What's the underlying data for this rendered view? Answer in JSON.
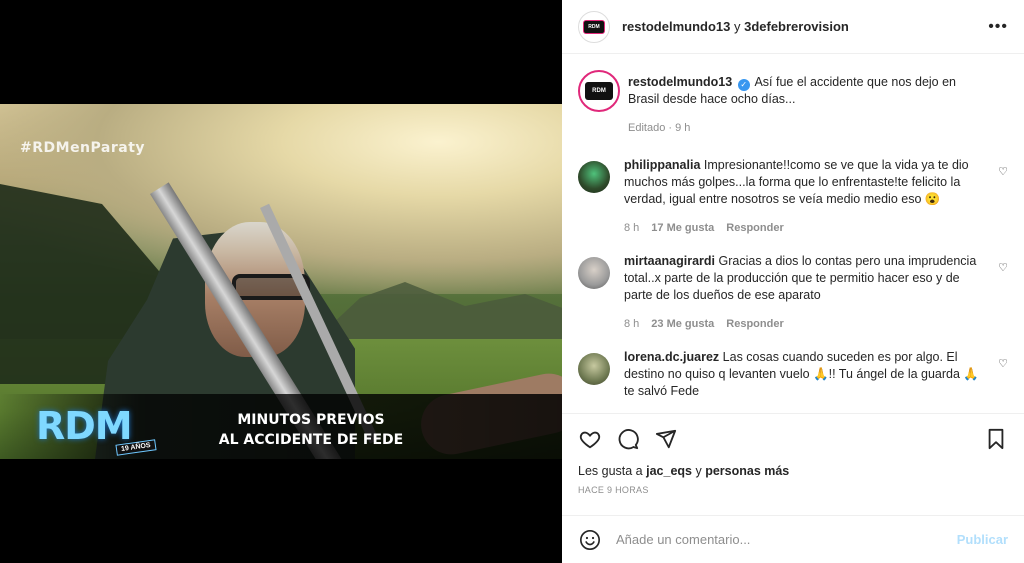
{
  "media": {
    "hashtag": "#RDMenParaty",
    "logo_text": "RDM",
    "logo_years": "19 AÑOS",
    "caption_line1": "MINUTOS PREVIOS",
    "caption_line2": "AL ACCIDENTE DE FEDE"
  },
  "header": {
    "user1": "restodelmundo13",
    "joiner": " y ",
    "user2": "3defebrerovision",
    "more_icon": "more-horizontal-icon"
  },
  "caption": {
    "username": "restodelmundo13",
    "text": "Así fue el accidente que nos dejo en Brasil desde hace ocho días...",
    "edited": "Editado · 9 h"
  },
  "comments": [
    {
      "username": "philippanalia",
      "text": "Impresionante!!como se ve que la vida ya te dio muchos más golpes...la forma que lo enfrentaste!te felicito la verdad, igual entre nosotros se veía medio medio eso 😮",
      "time": "8 h",
      "likes": "17 Me gusta",
      "reply": "Responder",
      "avatar_color": "#2e4a2a"
    },
    {
      "username": "mirtaanagirardi",
      "text": "Gracias a dios lo contas pero una imprudencia total..x parte de la producción que te permitio hacer eso y de parte de los dueños de ese aparato",
      "time": "8 h",
      "likes": "23 Me gusta",
      "reply": "Responder",
      "avatar_color": "#9a9a9a"
    },
    {
      "username": "lorena.dc.juarez",
      "text": "Las cosas cuando suceden es por algo. El destino no quiso q levanten vuelo 🙏!! Tu ángel de la guarda 🙏 te salvó Fede",
      "time": "",
      "likes": "",
      "reply": "",
      "avatar_color": "#6f7a52"
    }
  ],
  "actions": {
    "likes_prefix": "Les gusta a ",
    "likes_user": "jac_eqs",
    "likes_mid": " y ",
    "likes_rest": "personas más",
    "time_ago": "HACE 9 HORAS"
  },
  "add_comment": {
    "placeholder": "Añade un comentario...",
    "post_label": "Publicar"
  },
  "colors": {
    "accent": "#3897f0",
    "post_disabled": "#b2dffc",
    "muted": "#8e8e8e"
  }
}
